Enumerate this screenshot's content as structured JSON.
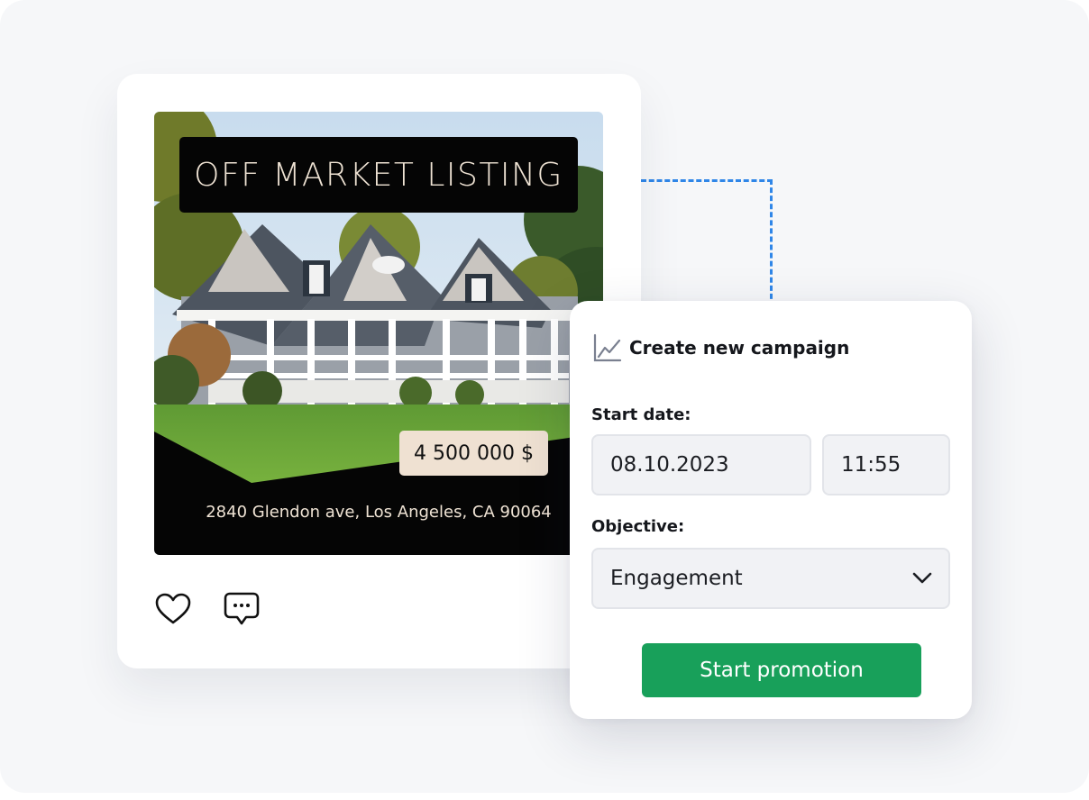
{
  "post": {
    "banner_text": "OFF MARKET LISTING",
    "price": "4 500 000 $",
    "address": "2840 Glendon ave, Los Angeles, CA 90064",
    "actions": [
      {
        "name": "like",
        "icon": "heart-icon"
      },
      {
        "name": "comment",
        "icon": "comment-icon"
      }
    ]
  },
  "campaign": {
    "title": "Create new campaign",
    "title_icon": "line-chart-icon",
    "start_date_label": "Start date:",
    "start_date_value": "08.10.2023",
    "start_time_value": "11:55",
    "objective_label": "Objective:",
    "objective_value": "Engagement",
    "submit_label": "Start promotion"
  },
  "colors": {
    "accent_green": "#18a05a",
    "connector_blue": "#2f86e8",
    "banner_text": "#efe3d4",
    "price_tag_bg": "#efe1d2"
  }
}
